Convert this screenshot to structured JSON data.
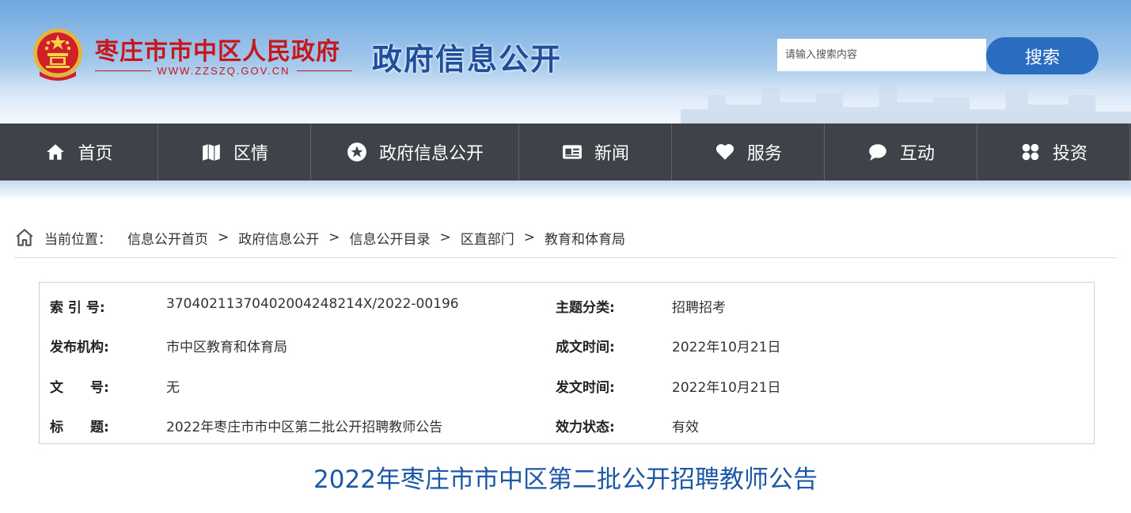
{
  "header": {
    "site_name": "枣庄市市中区人民政府",
    "site_url": "WWW.ZZSZQ.GOV.CN",
    "section_title": "政府信息公开",
    "search": {
      "placeholder": "请输入搜索内容",
      "value": "",
      "button_label": "搜索"
    }
  },
  "nav": {
    "items": [
      {
        "label": "首页",
        "icon": "home-icon"
      },
      {
        "label": "区情",
        "icon": "map-icon"
      },
      {
        "label": "政府信息公开",
        "icon": "star-icon"
      },
      {
        "label": "新闻",
        "icon": "news-icon"
      },
      {
        "label": "服务",
        "icon": "heart-icon"
      },
      {
        "label": "互动",
        "icon": "chat-icon"
      },
      {
        "label": "投资",
        "icon": "grid-icon"
      }
    ]
  },
  "breadcrumb": {
    "label": "当前位置：",
    "separator": ">",
    "items": [
      "信息公开首页",
      "政府信息公开",
      "信息公开目录",
      "区直部门",
      "教育和体育局"
    ]
  },
  "info": {
    "rows": [
      {
        "k1": "索 引 号:",
        "v1": "37040211370402004248214X/2022-00196",
        "k2": "主题分类:",
        "v2": "招聘招考"
      },
      {
        "k1": "发布机构:",
        "v1": "市中区教育和体育局",
        "k2": "成文时间:",
        "v2": "2022年10月21日"
      },
      {
        "k1": "文　　号:",
        "v1": "无",
        "k2": "发文时间:",
        "v2": "2022年10月21日"
      },
      {
        "k1": "标　　题:",
        "v1": "2022年枣庄市市中区第二批公开招聘教师公告",
        "k2": "效力状态:",
        "v2": "有效"
      }
    ]
  },
  "article": {
    "title": "2022年枣庄市市中区第二批公开招聘教师公告"
  },
  "colors": {
    "brand_red": "#c8161d",
    "title_blue": "#1d4f9a",
    "nav_bg": "#3d4349",
    "button_blue": "#2a6cc0"
  }
}
